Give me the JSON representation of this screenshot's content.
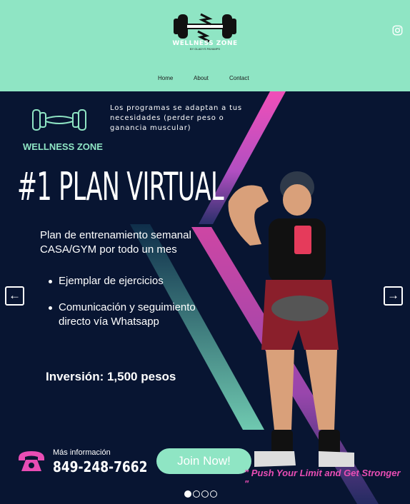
{
  "header": {
    "brand": "WELLNESS ZONE",
    "brand_sub": "BY GLADYS PAYAMPS",
    "nav": [
      "Home",
      "About",
      "Contact"
    ],
    "social_icon": "instagram-icon",
    "bg_color": "#8fe5c4"
  },
  "hero": {
    "brand_label": "WELLNESS ZONE",
    "tagline": "Los programas se adaptan a tus necesidades (perder peso o ganancia muscular)",
    "headline": "#1 PLAN VIRTUAL",
    "description": "Plan de entrenamiento semanal CASA/GYM por todo un mes",
    "bullets": [
      "Ejemplar de ejercicios",
      "Comunicación y seguimiento directo vía Whatsapp"
    ],
    "price": "Inversión: 1,500 pesos",
    "contact_label": "Más información",
    "phone": "849-248-7662",
    "cta": "Join Now!",
    "quote": "\" Push Your Limit and Get Stronger \"",
    "slides": 4,
    "active_slide": 1,
    "colors": {
      "bg": "#081532",
      "accent": "#8fe5c4",
      "pink": "#e84db4"
    }
  }
}
